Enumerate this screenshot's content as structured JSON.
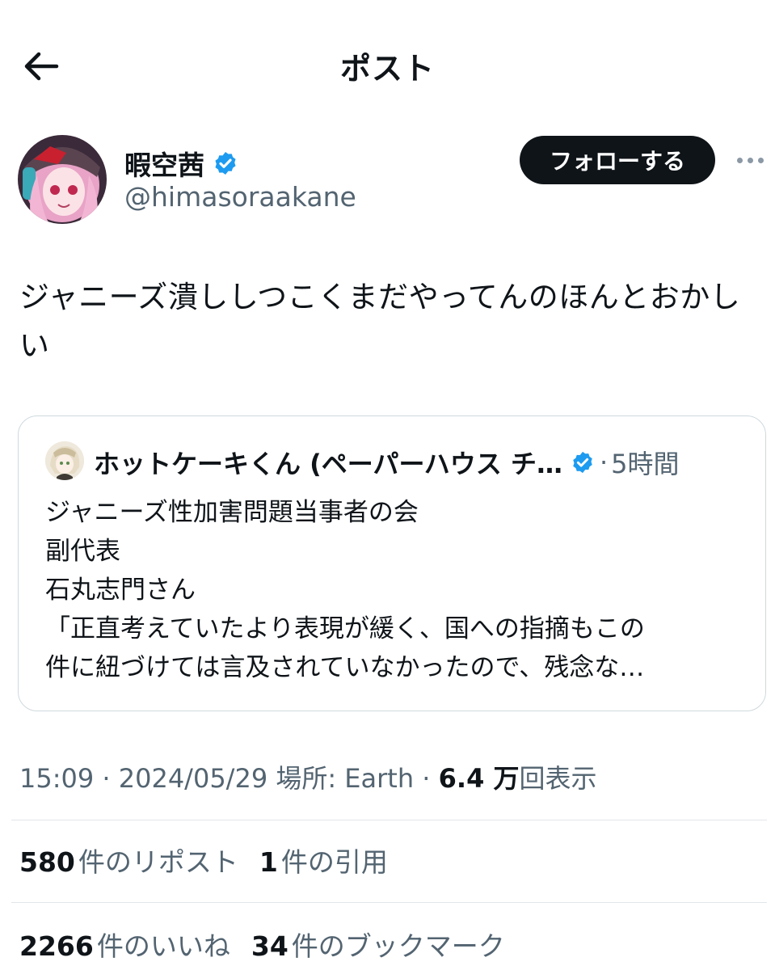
{
  "header": {
    "title": "ポスト",
    "back_icon": "arrow-left-icon"
  },
  "author": {
    "display_name": "暇空茜",
    "handle": "@himasoraakane",
    "verified": true,
    "badge_color": "#1d9bf0",
    "follow_label": "フォローする"
  },
  "post": {
    "text": "ジャニーズ潰ししつこくまだやってんのほんとおかしい"
  },
  "quote": {
    "author_name": "ホットケーキくん (ペーパーハウス チ…",
    "verified": true,
    "separator": "·",
    "time": "5時間",
    "lines": [
      "ジャニーズ性加害問題当事者の会",
      "副代表",
      "石丸志門さん",
      "「正直考えていたより表現が緩く、国への指摘もこの",
      "件に紐づけては言及されていなかったので、残念な…"
    ]
  },
  "meta": {
    "time": "15:09",
    "sep1": "·",
    "date": "2024/05/29",
    "location_label": "場所: Earth",
    "sep2": "·",
    "views_count": "6.4 万",
    "views_label": "回表示"
  },
  "stats": {
    "reposts_count": "580",
    "reposts_label": "件のリポスト",
    "quotes_count": "1",
    "quotes_label": "件の引用",
    "likes_count": "2266",
    "likes_label": "件のいいね",
    "bookmarks_count": "34",
    "bookmarks_label": "件のブックマーク"
  }
}
